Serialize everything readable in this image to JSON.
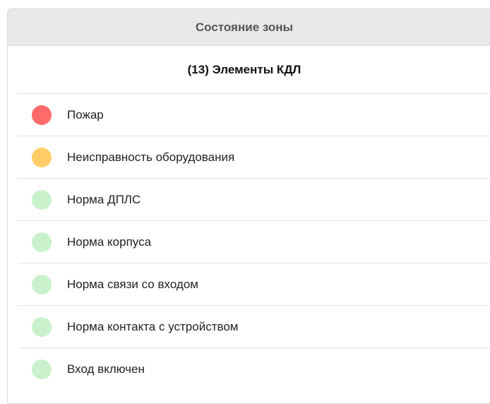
{
  "panel": {
    "title": "Состояние зоны",
    "subtitle": "(13) Элементы КДЛ"
  },
  "colors": {
    "fire": "#ff6b6b",
    "fault": "#ffcc66",
    "normal": "#c9f2cc"
  },
  "items": [
    {
      "label": "Пожар",
      "status": "fire",
      "icon": "status-dot-icon"
    },
    {
      "label": "Неисправность оборудования",
      "status": "fault",
      "icon": "status-dot-icon"
    },
    {
      "label": "Норма ДПЛС",
      "status": "normal",
      "icon": "status-dot-icon"
    },
    {
      "label": "Норма корпуса",
      "status": "normal",
      "icon": "status-dot-icon"
    },
    {
      "label": "Норма связи со входом",
      "status": "normal",
      "icon": "status-dot-icon"
    },
    {
      "label": "Норма контакта с устройством",
      "status": "normal",
      "icon": "status-dot-icon"
    },
    {
      "label": "Вход включен",
      "status": "normal",
      "icon": "status-dot-icon"
    }
  ]
}
